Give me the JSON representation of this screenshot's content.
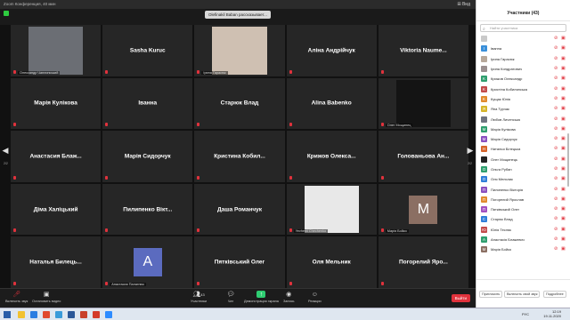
{
  "window": {
    "title": "Zoom Конференция, 40 мин",
    "view_label": "Вид"
  },
  "toast": "Olefinakil Baban рассказывает...",
  "tiles": [
    {
      "name": "",
      "tag": "Олександр Чаплинський",
      "type": "video",
      "bg": "#6b6e74"
    },
    {
      "name": "Sasha Kuruc",
      "tag": "",
      "type": "name"
    },
    {
      "name": "",
      "tag": "Ірина Гарасюк",
      "type": "video",
      "bg": "#cfc0b2"
    },
    {
      "name": "Аліна Андрійчук",
      "tag": "",
      "type": "name"
    },
    {
      "name": "Viktoria  Naume...",
      "tag": "",
      "type": "name"
    },
    {
      "name": "Марія Кулікова",
      "tag": "",
      "type": "name"
    },
    {
      "name": "Іванна",
      "tag": "",
      "type": "name"
    },
    {
      "name": "Старюк Влад",
      "tag": "",
      "type": "name"
    },
    {
      "name": "Alina Babenko",
      "tag": "",
      "type": "name"
    },
    {
      "name": "",
      "tag": "Олег Мощинец",
      "type": "video",
      "bg": "#141414"
    },
    {
      "name": "Анастасия  Блаж...",
      "tag": "",
      "type": "name"
    },
    {
      "name": "Марія Сидорчук",
      "tag": "",
      "type": "name"
    },
    {
      "name": "Кристина  Кобил...",
      "tag": "",
      "type": "name"
    },
    {
      "name": "Крижов  Олекса...",
      "tag": "",
      "type": "name"
    },
    {
      "name": "Голованьова  Ан...",
      "tag": "",
      "type": "name"
    },
    {
      "name": "Діма Халіцький",
      "tag": "",
      "type": "name"
    },
    {
      "name": "Пилипенко  Вікт...",
      "tag": "",
      "type": "name"
    },
    {
      "name": "Даша Романчук",
      "tag": "",
      "type": "name"
    },
    {
      "name": "",
      "tag": "Yevhenii Chechenko",
      "type": "video",
      "bg": "#e8e8e8"
    },
    {
      "name": "",
      "tag": "Марія Бойко",
      "type": "avatar",
      "letter": "M",
      "color": "#8b6f63"
    },
    {
      "name": "Наталья  Билець...",
      "tag": "",
      "type": "name"
    },
    {
      "name": "",
      "tag": "Анастасия Палагнюк",
      "type": "avatar",
      "letter": "A",
      "color": "#5b6bbf"
    },
    {
      "name": "Пятківський Олег",
      "tag": "",
      "type": "name"
    },
    {
      "name": "Оля Мельник",
      "tag": "",
      "type": "name"
    },
    {
      "name": "Погорелий  Яро...",
      "tag": "",
      "type": "name"
    }
  ],
  "pager": {
    "left": "2/2",
    "right": "2/2"
  },
  "toolbar": {
    "unmute": "Включить звук",
    "start_video": "Остановить видео",
    "participants": "Участники",
    "participants_count": "43",
    "chat": "Чат",
    "share": "Демонстрация экрана",
    "record": "Запись",
    "reactions": "Реакции",
    "end": "Выйти"
  },
  "panel": {
    "title": "Участники (43)",
    "search_placeholder": "Найти участника",
    "participants": [
      {
        "name": "",
        "letter": "",
        "color": "#c9c9c9"
      },
      {
        "name": "Іванна",
        "letter": "I",
        "color": "#3a8fd9"
      },
      {
        "name": "Ірина Гарасюк",
        "letter": "",
        "color": "#b7a89a"
      },
      {
        "name": "Ірина Кондратович",
        "letter": "",
        "color": "#9a8f8f"
      },
      {
        "name": "Крижов Олександр",
        "letter": "K",
        "color": "#2f9e6e"
      },
      {
        "name": "Кристіна Кобилянська",
        "letter": "K",
        "color": "#c24a4a"
      },
      {
        "name": "Кущак Юлія",
        "letter": "K",
        "color": "#e08a2e"
      },
      {
        "name": "Яна Турчак",
        "letter": "Я",
        "color": "#d6b52a"
      },
      {
        "name": "Любов Личенська",
        "letter": "",
        "color": "#6f7480"
      },
      {
        "name": "Марія Кулікова",
        "letter": "M",
        "color": "#2f9e6e"
      },
      {
        "name": "Марія Сидорчук",
        "letter": "M",
        "color": "#8a4fbf"
      },
      {
        "name": "Наталья Білецька",
        "letter": "H",
        "color": "#d6642a"
      },
      {
        "name": "Олег Мощинець",
        "letter": "",
        "color": "#222222"
      },
      {
        "name": "Ольга Рубан",
        "letter": "O",
        "color": "#2f9e6e"
      },
      {
        "name": "Оля Мельник",
        "letter": "O",
        "color": "#2f7ed9"
      },
      {
        "name": "Пилипенко Вікторія",
        "letter": "П",
        "color": "#8a4fbf"
      },
      {
        "name": "Погорелий Ярослав",
        "letter": "П",
        "color": "#e08a2e"
      },
      {
        "name": "Пятківський Олег",
        "letter": "П",
        "color": "#a24fbf"
      },
      {
        "name": "Старюк Влад",
        "letter": "C",
        "color": "#2f7ed9"
      },
      {
        "name": "Юлія Тесляк",
        "letter": "Ю",
        "color": "#c24a4a"
      },
      {
        "name": "Анастасія Блажевич",
        "letter": "A",
        "color": "#2f9e6e"
      },
      {
        "name": "Марія Бойко",
        "letter": "M",
        "color": "#8b6f63"
      }
    ],
    "invite": "Пригласить",
    "unmute_me": "Включить свой звук",
    "more": "Подробнее"
  },
  "taskbar": {
    "lang": "РУС",
    "time": "12:19",
    "date": "19.11.2020"
  }
}
